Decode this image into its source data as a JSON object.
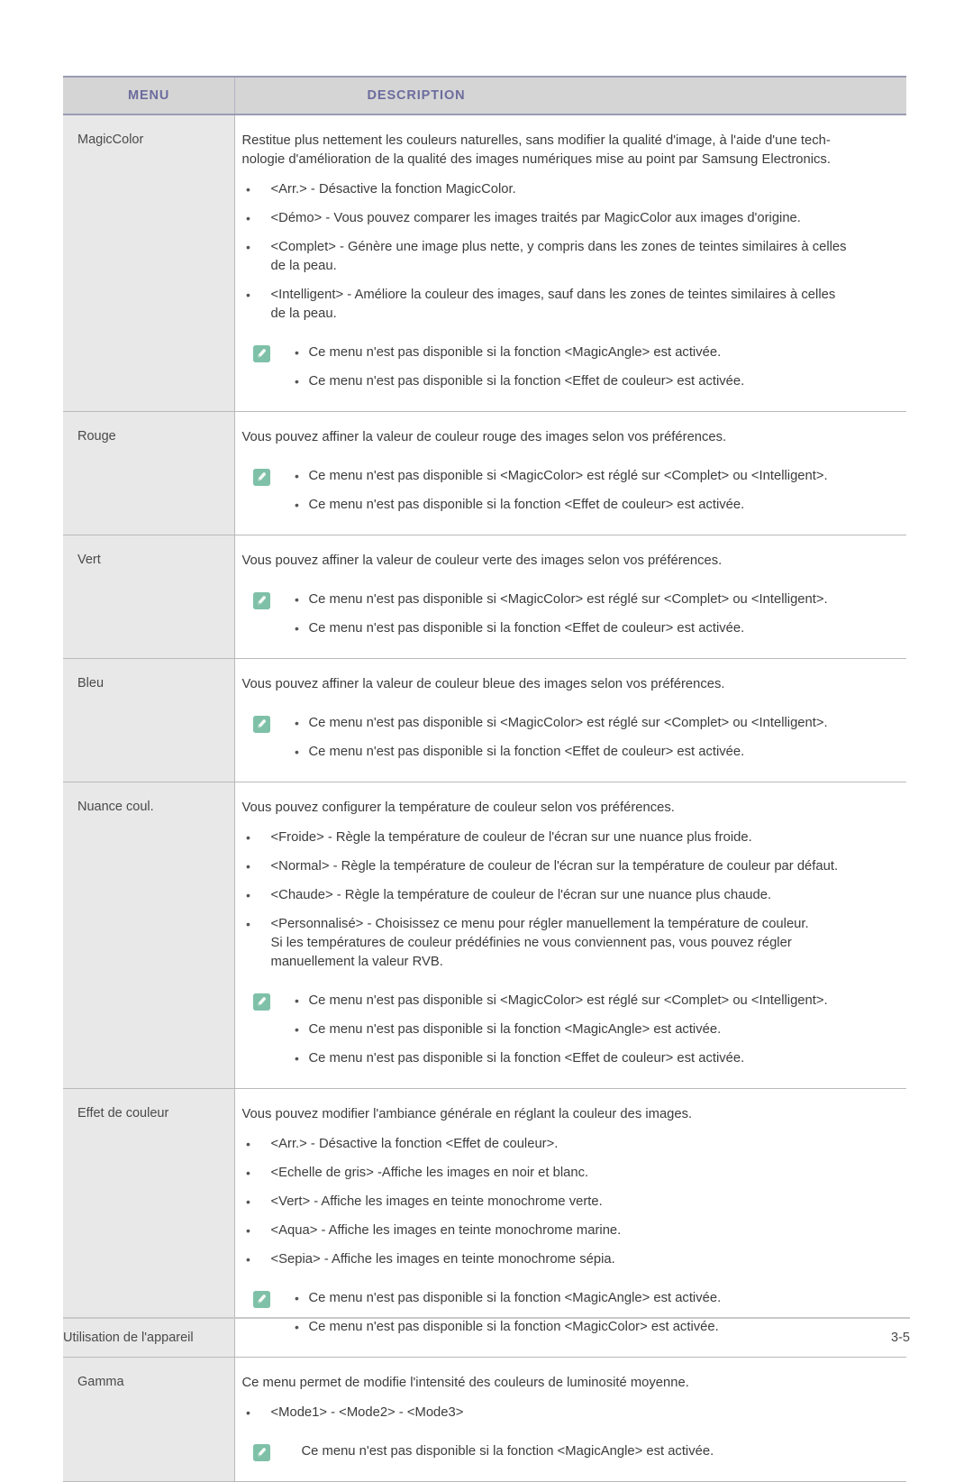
{
  "table": {
    "headers": {
      "menu": "MENU",
      "description": "DESCRIPTION"
    },
    "header_text_color": "#6c6c9e",
    "header_bg_color": "#d5d5d5",
    "menu_col_bg_color": "#e8e8e8",
    "note_icon_color": "#7fc0a8",
    "rows": [
      {
        "menu": "MagicColor",
        "intro": [
          "Restitue plus nettement les couleurs naturelles, sans modifier la qualité d'image, à l'aide d'une tech-",
          "nologie d'amélioration de la qualité des images numériques mise au point par Samsung Electronics."
        ],
        "bullets": [
          {
            "main": "<Arr.> - Désactive la fonction MagicColor."
          },
          {
            "main": "<Démo> - Vous pouvez comparer les images traités par MagicColor aux images d'origine."
          },
          {
            "main": "<Complet> - Génère une image plus nette, y compris dans les zones de teintes similaires à celles",
            "sub": "de la peau."
          },
          {
            "main": "<Intelligent> - Améliore la couleur des images, sauf dans les zones de teintes similaires à celles",
            "sub": "de la peau."
          }
        ],
        "notes": [
          "Ce menu n'est pas disponible si la fonction <MagicAngle> est activée.",
          "Ce menu n'est pas disponible si la fonction <Effet de couleur> est activée."
        ],
        "notes_bulleted": true
      },
      {
        "menu": "Rouge",
        "intro": [
          "Vous pouvez affiner la valeur de couleur rouge des images selon vos préférences."
        ],
        "bullets": [],
        "notes": [
          "Ce menu n'est pas disponible si <MagicColor> est réglé sur <Complet> ou <Intelligent>.",
          "Ce menu n'est pas disponible si la fonction <Effet de couleur> est activée."
        ],
        "notes_bulleted": true
      },
      {
        "menu": "Vert",
        "intro": [
          "Vous pouvez affiner la valeur de couleur verte des images selon vos préférences."
        ],
        "bullets": [],
        "notes": [
          "Ce menu n'est pas disponible si <MagicColor> est réglé sur <Complet> ou <Intelligent>.",
          "Ce menu n'est pas disponible si la fonction <Effet de couleur> est activée."
        ],
        "notes_bulleted": true
      },
      {
        "menu": "Bleu",
        "intro": [
          "Vous pouvez affiner la valeur de couleur bleue des images selon vos préférences."
        ],
        "bullets": [],
        "notes": [
          "Ce menu n'est pas disponible si <MagicColor> est réglé sur <Complet> ou <Intelligent>.",
          "Ce menu n'est pas disponible si la fonction <Effet de couleur> est activée."
        ],
        "notes_bulleted": true
      },
      {
        "menu": "Nuance coul.",
        "intro": [
          "Vous pouvez configurer la température de couleur selon vos préférences."
        ],
        "bullets": [
          {
            "main": "<Froide> - Règle la température de couleur de l'écran sur une nuance plus froide."
          },
          {
            "main": "<Normal> - Règle la température de couleur de l'écran sur la température de couleur par défaut."
          },
          {
            "main": "<Chaude> - Règle la température de couleur de l'écran sur une nuance plus chaude."
          },
          {
            "main": "<Personnalisé> - Choisissez ce menu pour régler manuellement la température de couleur.",
            "sub": "Si les températures de couleur prédéfinies ne vous conviennent pas, vous pouvez régler",
            "sub2": "manuellement la valeur RVB."
          }
        ],
        "notes": [
          "Ce menu n'est pas disponible si <MagicColor> est réglé sur <Complet> ou <Intelligent>.",
          "Ce menu n'est pas disponible si la fonction <MagicAngle> est activée.",
          "Ce menu n'est pas disponible si la fonction <Effet de couleur> est activée."
        ],
        "notes_bulleted": true
      },
      {
        "menu": "Effet de couleur",
        "intro": [
          "Vous pouvez modifier l'ambiance générale en réglant la couleur des images."
        ],
        "bullets": [
          {
            "main": "<Arr.> - Désactive la fonction <Effet de couleur>."
          },
          {
            "main": "<Echelle de gris> -Affiche les images en noir et blanc."
          },
          {
            "main": "<Vert> - Affiche les images en teinte monochrome verte."
          },
          {
            "main": "<Aqua> - Affiche les images en teinte monochrome marine."
          },
          {
            "main": "<Sepia> - Affiche les images en teinte monochrome sépia."
          }
        ],
        "notes": [
          "Ce menu n'est pas disponible si la fonction <MagicAngle> est activée.",
          "Ce menu n'est pas disponible si la fonction <MagicColor> est activée."
        ],
        "notes_bulleted": true
      },
      {
        "menu": "Gamma",
        "intro": [
          "Ce menu permet de modifie l'intensité des couleurs de luminosité moyenne."
        ],
        "bullets": [
          {
            "main": "<Mode1> - <Mode2> - <Mode3>"
          }
        ],
        "notes": [
          "Ce menu n'est pas disponible si la fonction <MagicAngle> est activée."
        ],
        "notes_bulleted": false
      }
    ]
  },
  "footer": {
    "left": "Utilisation de l'appareil",
    "right": "3-5"
  },
  "bullet_glyph": "•"
}
